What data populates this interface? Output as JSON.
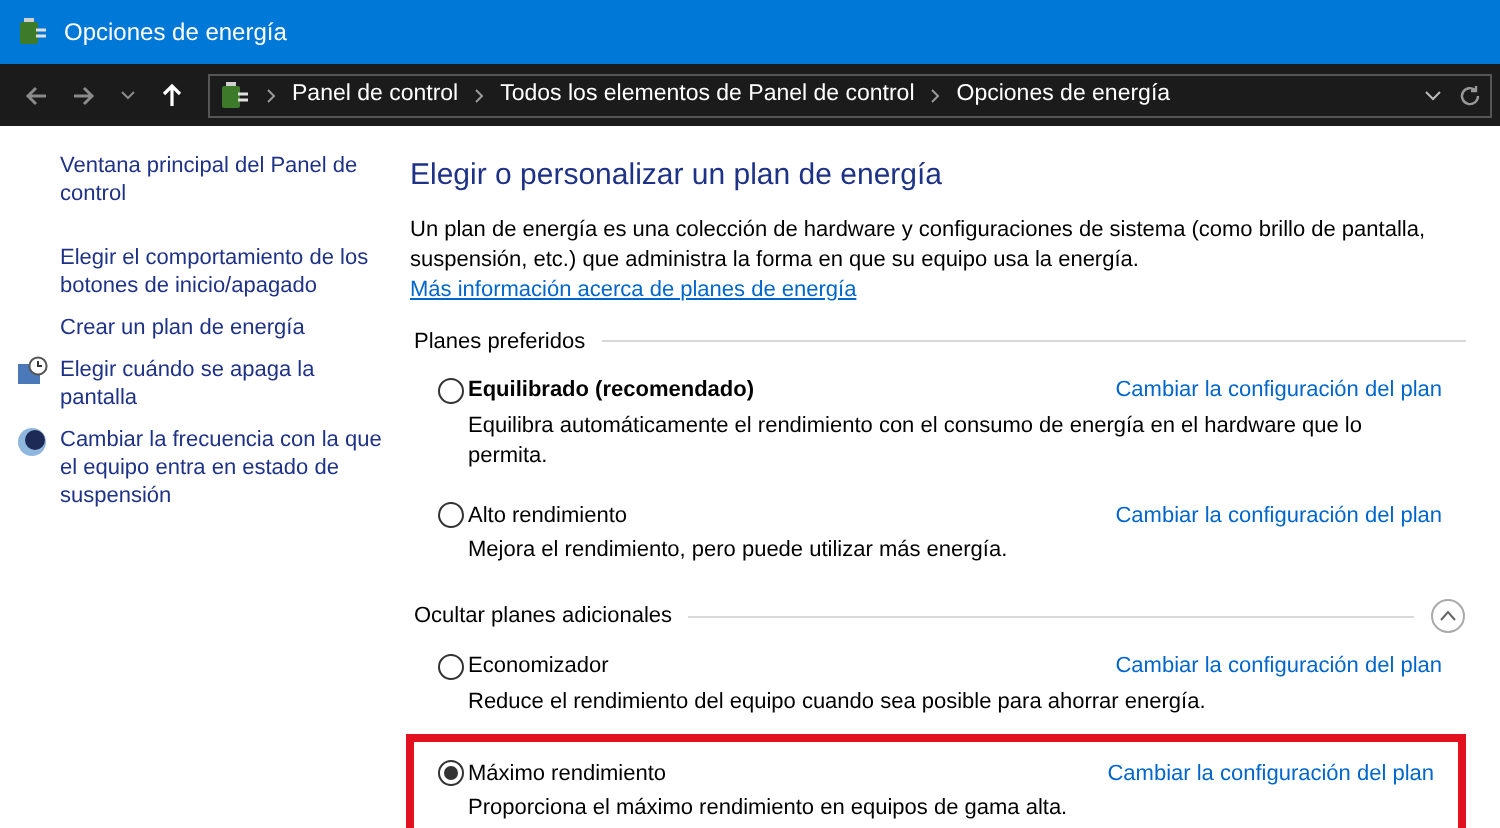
{
  "window": {
    "title": "Opciones de energía"
  },
  "address_bar": {
    "breadcrumbs": [
      "Panel de control",
      "Todos los elementos de Panel de control",
      "Opciones de energía"
    ]
  },
  "sidebar": {
    "items": [
      {
        "label": "Ventana principal del Panel de control",
        "kind": "plain"
      },
      {
        "label": "Elegir el comportamiento de los botones de inicio/apagado",
        "kind": "plain"
      },
      {
        "label": "Crear un plan de energía",
        "kind": "plain"
      },
      {
        "label": "Elegir cuándo se apaga la pantalla",
        "kind": "clock"
      },
      {
        "label": "Cambiar la frecuencia con la que el equipo entra en estado de suspensión",
        "kind": "moon"
      }
    ]
  },
  "main": {
    "heading": "Elegir o personalizar un plan de energía",
    "description": "Un plan de energía es una colección de hardware y configuraciones de sistema (como brillo de pantalla, suspensión, etc.) que administra la forma en que su equipo usa la energía.",
    "more_info_link": "Más información acerca de planes de energía",
    "groups": [
      {
        "title": "Planes preferidos",
        "collapse_button": false,
        "plans": [
          {
            "name": "Equilibrado (recomendado)",
            "bold": true,
            "selected": false,
            "highlighted": false,
            "link": "Cambiar la configuración del plan",
            "description": "Equilibra automáticamente el rendimiento con el consumo de energía en el hardware que lo permita."
          },
          {
            "name": "Alto rendimiento",
            "bold": false,
            "selected": false,
            "highlighted": false,
            "link": "Cambiar la configuración del plan",
            "description": "Mejora el rendimiento, pero puede utilizar más energía."
          }
        ]
      },
      {
        "title": "Ocultar planes adicionales",
        "collapse_button": true,
        "plans": [
          {
            "name": "Economizador",
            "bold": false,
            "selected": false,
            "highlighted": false,
            "link": "Cambiar la configuración del plan",
            "description": "Reduce el rendimiento del equipo cuando sea posible para ahorrar energía."
          },
          {
            "name": "Máximo rendimiento",
            "bold": false,
            "selected": true,
            "highlighted": true,
            "link": "Cambiar la configuración del plan",
            "description": "Proporciona el máximo rendimiento en equipos de gama alta."
          }
        ]
      }
    ]
  }
}
